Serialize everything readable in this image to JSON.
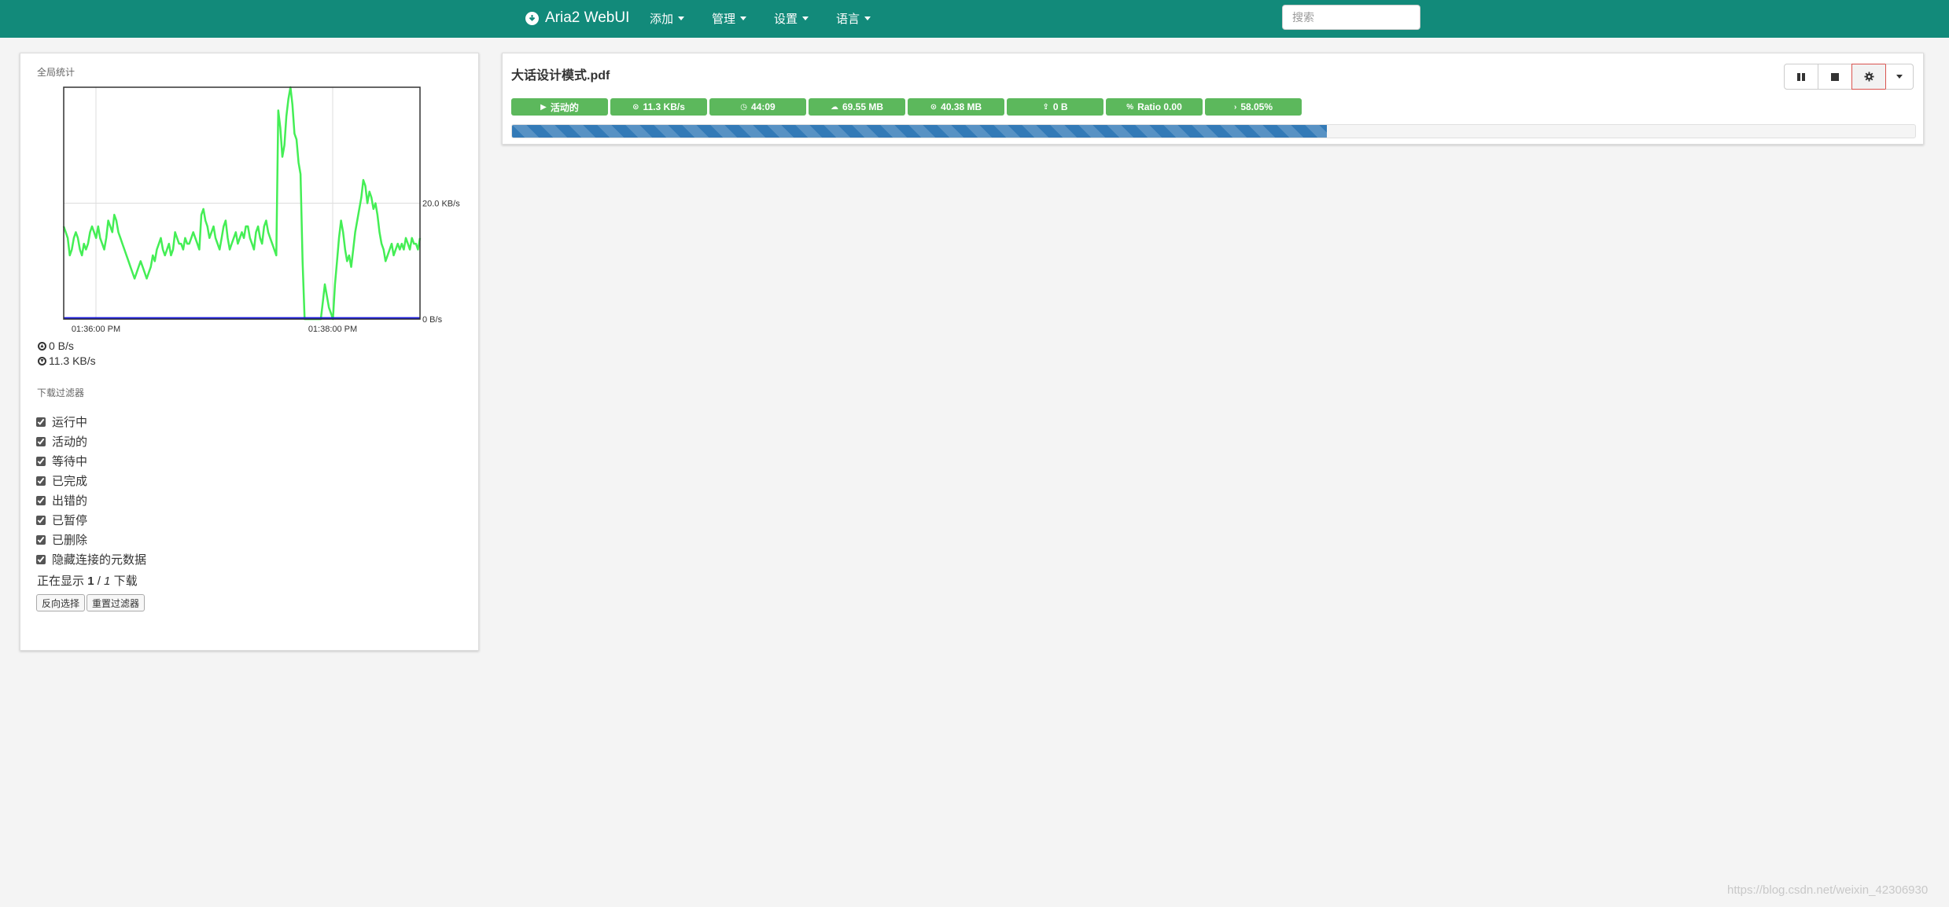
{
  "navbar": {
    "brand": "Aria2 WebUI",
    "brand_icon": "download-circle-icon",
    "menu": [
      {
        "label": "添加"
      },
      {
        "label": "管理"
      },
      {
        "label": "设置"
      },
      {
        "label": "语言"
      }
    ],
    "search_placeholder": "搜索"
  },
  "stats": {
    "title": "全局统计",
    "upload_speed": "0 B/s",
    "download_speed": "11.3 KB/s"
  },
  "chart_data": {
    "type": "line",
    "title": "",
    "x_tick_labels": [
      "01:36:00 PM",
      "01:38:00 PM"
    ],
    "y_tick_labels": [
      "20.0 KB/s",
      "0 B/s"
    ],
    "ylim": [
      0,
      40
    ],
    "grid": true,
    "series": [
      {
        "color": "#44ee55",
        "values": [
          16,
          15,
          14,
          11,
          12,
          14,
          15,
          14,
          12,
          11,
          13,
          12,
          13,
          15,
          16,
          15,
          14,
          16,
          14,
          13,
          12,
          14,
          17,
          16,
          15,
          18,
          17,
          15,
          14,
          13,
          12,
          11,
          10,
          9,
          8,
          7,
          8,
          9,
          10,
          9,
          8,
          7,
          8,
          9,
          11,
          10,
          12,
          13,
          14,
          12,
          11,
          12,
          13,
          11,
          12,
          15,
          14,
          13,
          13,
          12,
          14,
          13,
          13,
          14,
          15,
          14,
          13,
          12,
          18,
          19,
          17,
          16,
          14,
          15,
          16,
          14,
          13,
          12,
          14,
          16,
          17,
          14,
          12,
          13,
          14,
          15,
          13,
          14,
          15,
          14,
          16,
          16,
          14,
          13,
          12,
          15,
          16,
          14,
          13,
          16,
          17,
          15,
          14,
          13,
          12,
          11,
          36,
          33,
          28,
          30,
          35,
          38,
          40,
          37,
          32,
          31,
          27,
          25,
          10,
          0,
          0,
          0,
          0,
          0,
          0,
          0,
          0,
          0,
          3,
          6,
          4,
          2,
          1,
          0,
          6,
          10,
          14,
          17,
          15,
          12,
          10,
          11,
          9,
          12,
          15,
          17,
          19,
          21,
          24,
          23,
          20,
          22,
          21,
          19,
          20,
          18,
          15,
          13,
          12,
          10,
          11,
          12,
          13,
          11,
          12,
          13,
          12,
          13,
          12,
          14,
          13,
          12,
          14,
          13,
          13,
          12,
          14
        ],
        "resolution_note": ""
      },
      {
        "color": "#1a1adc",
        "values": [
          0,
          0
        ]
      }
    ]
  },
  "filters": {
    "title": "下载过滤器",
    "items": [
      {
        "label": "运行中",
        "checked": true
      },
      {
        "label": "活动的",
        "checked": true
      },
      {
        "label": "等待中",
        "checked": true
      },
      {
        "label": "已完成",
        "checked": true
      },
      {
        "label": "出错的",
        "checked": true
      },
      {
        "label": "已暂停",
        "checked": true
      },
      {
        "label": "已删除",
        "checked": true
      },
      {
        "label": "隐藏连接的元数据",
        "checked": true
      }
    ],
    "showing_prefix": "正在显示",
    "showing_current": "1",
    "showing_sep": "/",
    "showing_total": "1",
    "showing_suffix": "下载",
    "invert_label": "反向选择",
    "reset_label": "重置过滤器"
  },
  "download": {
    "name": "大话设计模式.pdf",
    "badges": [
      {
        "icon": "play-icon",
        "glyph": "▶",
        "text": "活动的"
      },
      {
        "icon": "download-speed-icon",
        "glyph": "⊙",
        "text": "11.3 KB/s"
      },
      {
        "icon": "clock-icon",
        "glyph": "◷",
        "text": "44:09"
      },
      {
        "icon": "cloud-download-icon",
        "glyph": "☁",
        "text": "69.55 MB"
      },
      {
        "icon": "downloaded-icon",
        "glyph": "⊙",
        "text": "40.38 MB"
      },
      {
        "icon": "upload-icon",
        "glyph": "⇪",
        "text": "0 B"
      },
      {
        "icon": "ratio-icon",
        "glyph": "%",
        "text": "Ratio 0.00"
      },
      {
        "icon": "chevron-right-icon",
        "glyph": "›",
        "text": "58.05%"
      }
    ],
    "progress": 0.5805,
    "colors": {
      "badge": "#5cb85c",
      "progress": "#337ab7"
    }
  },
  "watermark": "https://blog.csdn.net/weixin_42306930"
}
